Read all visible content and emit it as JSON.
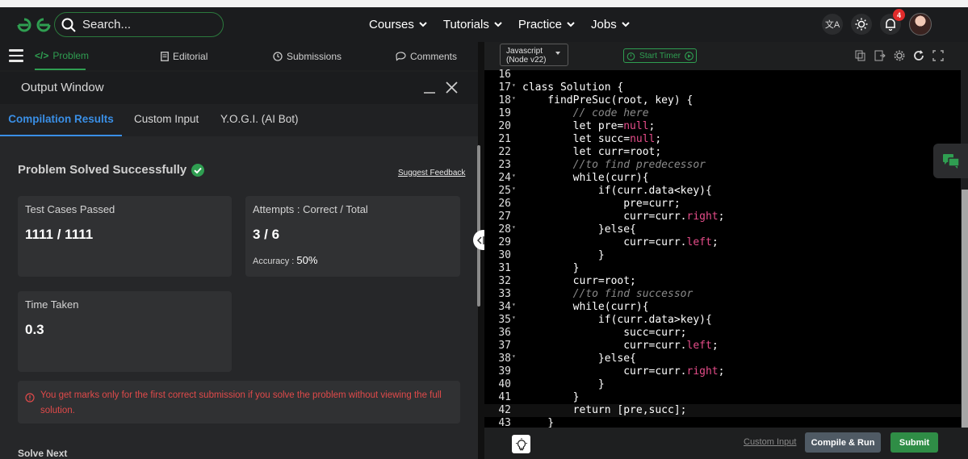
{
  "navbar": {
    "search_placeholder": "Search...",
    "links": [
      "Courses",
      "Tutorials",
      "Practice",
      "Jobs"
    ],
    "notification_count": "4"
  },
  "problem_tabs": {
    "problem": "Problem",
    "editorial": "Editorial",
    "submissions": "Submissions",
    "comments": "Comments"
  },
  "output_window": {
    "title": "Output Window",
    "tabs": [
      "Compilation Results",
      "Custom Input",
      "Y.O.G.I. (AI Bot)"
    ],
    "status": "Problem Solved Successfully",
    "feedback_link": "Suggest Feedback",
    "test_cases_label": "Test Cases Passed",
    "test_cases_value": "1111 / 1111",
    "attempts_label": "Attempts : Correct / Total",
    "attempts_value": "3 / 6",
    "accuracy_label": "Accuracy :",
    "accuracy_value": "50%",
    "time_label": "Time Taken",
    "time_value": "0.3",
    "warning": "You get marks only for the first correct submission if you solve the problem without viewing the full solution.",
    "solve_next": "Solve Next"
  },
  "editor": {
    "language_line1": "Javascript",
    "language_line2": "(Node v22)",
    "timer_label": "Start Timer",
    "code_lines": [
      {
        "n": "16",
        "fold": false,
        "text": ""
      },
      {
        "n": "17",
        "fold": true,
        "text": "class Solution {"
      },
      {
        "n": "18",
        "fold": true,
        "text": "    findPreSuc(root, key) {"
      },
      {
        "n": "19",
        "fold": false,
        "text": "        // code here",
        "cls": "cm"
      },
      {
        "n": "20",
        "fold": false,
        "text": "        let pre=null;"
      },
      {
        "n": "21",
        "fold": false,
        "text": "        let succ=null;"
      },
      {
        "n": "22",
        "fold": false,
        "text": "        let curr=root;"
      },
      {
        "n": "23",
        "fold": false,
        "text": "        //to find predecessor",
        "cls": "cm"
      },
      {
        "n": "24",
        "fold": true,
        "text": "        while(curr){"
      },
      {
        "n": "25",
        "fold": true,
        "text": "            if(curr.data<key){"
      },
      {
        "n": "26",
        "fold": false,
        "text": "                pre=curr;"
      },
      {
        "n": "27",
        "fold": false,
        "text": "                curr=curr.right;"
      },
      {
        "n": "28",
        "fold": true,
        "text": "            }else{"
      },
      {
        "n": "29",
        "fold": false,
        "text": "                curr=curr.left;"
      },
      {
        "n": "30",
        "fold": false,
        "text": "            }"
      },
      {
        "n": "31",
        "fold": false,
        "text": "        }"
      },
      {
        "n": "32",
        "fold": false,
        "text": "        curr=root;"
      },
      {
        "n": "33",
        "fold": false,
        "text": "        //to find successor",
        "cls": "cm"
      },
      {
        "n": "34",
        "fold": true,
        "text": "        while(curr){"
      },
      {
        "n": "35",
        "fold": true,
        "text": "            if(curr.data>key){"
      },
      {
        "n": "36",
        "fold": false,
        "text": "                succ=curr;"
      },
      {
        "n": "37",
        "fold": false,
        "text": "                curr=curr.left;"
      },
      {
        "n": "38",
        "fold": true,
        "text": "            }else{"
      },
      {
        "n": "39",
        "fold": false,
        "text": "                curr=curr.right;"
      },
      {
        "n": "40",
        "fold": false,
        "text": "            }"
      },
      {
        "n": "41",
        "fold": false,
        "text": "        }"
      },
      {
        "n": "42",
        "fold": false,
        "text": "        return [pre,succ];",
        "hl": true
      },
      {
        "n": "43",
        "fold": false,
        "text": "    }"
      }
    ],
    "custom_input": "Custom Input",
    "compile_run": "Compile & Run",
    "submit": "Submit"
  },
  "colors": {
    "brand_green": "#2f9e51",
    "active_blue": "#3a8fe6",
    "warning_red": "#e04a4a",
    "keyword_pink": "#e64d8a"
  }
}
